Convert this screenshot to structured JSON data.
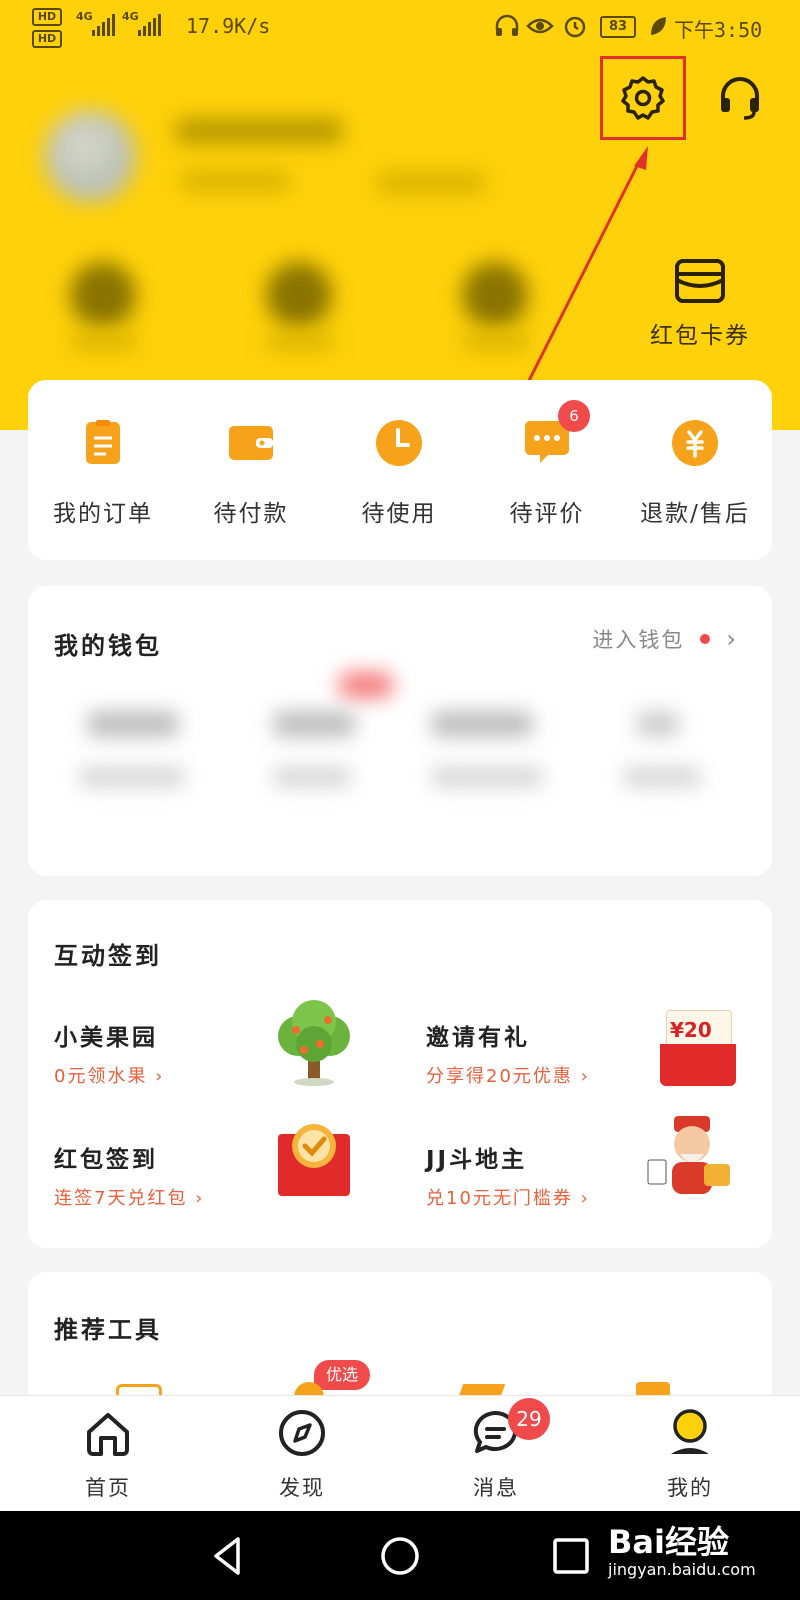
{
  "status_bar": {
    "speed": "17.9K/s",
    "net1": "4G",
    "net2": "4G",
    "hd": "HD",
    "battery": "83",
    "time": "下午3:50"
  },
  "header": {
    "settings_icon": "gear-icon",
    "service_icon": "headset-icon",
    "coupon_label": "红包卡券"
  },
  "orders": {
    "items": [
      {
        "label": "我的订单",
        "icon": "order-list-icon"
      },
      {
        "label": "待付款",
        "icon": "wallet-icon"
      },
      {
        "label": "待使用",
        "icon": "clock-icon"
      },
      {
        "label": "待评价",
        "icon": "comment-icon",
        "badge": "6"
      },
      {
        "label": "退款/售后",
        "icon": "refund-icon"
      }
    ]
  },
  "wallet": {
    "title": "我的钱包",
    "link_label": "进入钱包"
  },
  "checkin": {
    "title": "互动签到",
    "items": [
      {
        "title": "小美果园",
        "subtitle": "0元领水果 ›"
      },
      {
        "title": "邀请有礼",
        "subtitle": "分享得20元优惠 ›",
        "envelope_amount": "¥20"
      },
      {
        "title": "红包签到",
        "subtitle": "连签7天兑红包 ›"
      },
      {
        "title": "JJ斗地主",
        "subtitle": "兑10元无门槛券 ›"
      }
    ]
  },
  "tools": {
    "title": "推荐工具",
    "badge": "优选"
  },
  "tabbar": {
    "items": [
      {
        "label": "首页",
        "icon": "home-icon"
      },
      {
        "label": "发现",
        "icon": "compass-icon"
      },
      {
        "label": "消息",
        "icon": "message-icon",
        "badge": "29"
      },
      {
        "label": "我的",
        "icon": "profile-icon"
      }
    ]
  },
  "watermark": {
    "brand": "Bai经验",
    "url": "jingyan.baidu.com"
  },
  "colors": {
    "brand_yellow": "#fed10a",
    "accent_orange": "#f7a21b",
    "highlight_red": "#e0312a"
  }
}
